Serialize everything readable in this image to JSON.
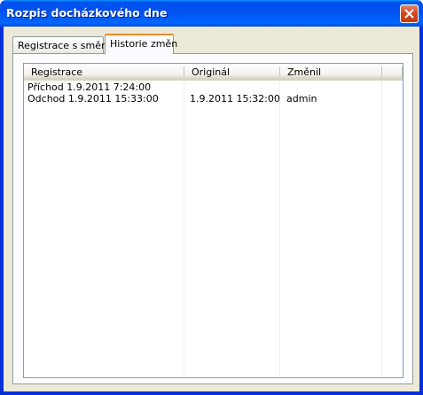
{
  "window": {
    "title": "Rozpis docházkového dne"
  },
  "tabs": [
    {
      "label": "Registrace s směny",
      "selected": false
    },
    {
      "label": "Historie změn",
      "selected": true
    }
  ],
  "table": {
    "columns": [
      "Registrace",
      "Originál",
      "Změnil"
    ],
    "rows": [
      [
        "Příchod 1.9.2011 7:24:00",
        "",
        ""
      ],
      [
        "Odchod 1.9.2011 15:33:00",
        "1.9.2011 15:32:00",
        "admin"
      ]
    ]
  },
  "colors": {
    "title_bar": "#0054e3",
    "close_button": "#d5471f",
    "dialog_bg": "#ece9d8",
    "selected_tab_accent": "#e68b2c"
  },
  "icons": {
    "close": "close-icon"
  }
}
